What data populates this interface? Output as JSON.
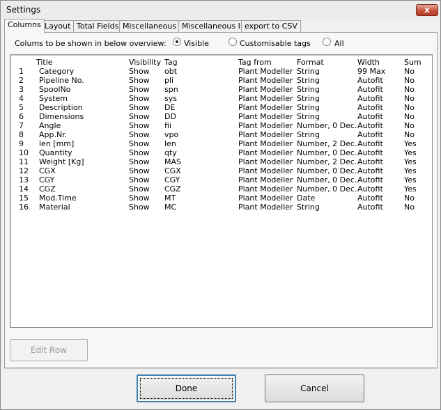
{
  "window": {
    "title": "Settings",
    "close_glyph": "x"
  },
  "tabs": [
    {
      "label": "Columns",
      "active": true
    },
    {
      "label": "Layout"
    },
    {
      "label": "Total Fields"
    },
    {
      "label": "Miscellaneous I"
    },
    {
      "label": "Miscellaneous II"
    },
    {
      "label": "export to CSV"
    }
  ],
  "filter": {
    "label": "Colums to be shown in below overview:",
    "options": [
      {
        "label": "Visible",
        "checked": true
      },
      {
        "label": "Customisable tags",
        "checked": false
      },
      {
        "label": "All",
        "checked": false
      }
    ]
  },
  "table": {
    "headers": [
      "",
      "Title",
      "Visibility",
      "Tag",
      "Tag from",
      "Format",
      "Width",
      "Sum"
    ],
    "rows": [
      [
        "1",
        "Category",
        "Show",
        "obt",
        "Plant Modeller",
        "String",
        "99 Max",
        "No"
      ],
      [
        "2",
        "Pipeline No.",
        "Show",
        "pli",
        "Plant Modeller",
        "String",
        "Autofit",
        "No"
      ],
      [
        "3",
        "SpoolNo",
        "Show",
        "spn",
        "Plant Modeller",
        "String",
        "Autofit",
        "No"
      ],
      [
        "4",
        "System",
        "Show",
        "sys",
        "Plant Modeller",
        "String",
        "Autofit",
        "No"
      ],
      [
        "5",
        "Description",
        "Show",
        "DE",
        "Plant Modeller",
        "String",
        "Autofit",
        "No"
      ],
      [
        "6",
        "Dimensions",
        "Show",
        "DD",
        "Plant Modeller",
        "String",
        "Autofit",
        "No"
      ],
      [
        "7",
        "Angle",
        "Show",
        "fii",
        "Plant Modeller",
        "Number, 0 Dec.",
        "Autofit",
        "No"
      ],
      [
        "8",
        "App.Nr.",
        "Show",
        "vpo",
        "Plant Modeller",
        "String",
        "Autofit",
        "No"
      ],
      [
        "9",
        "len [mm]",
        "Show",
        "len",
        "Plant Modeller",
        "Number, 2 Dec.",
        "Autofit",
        "Yes"
      ],
      [
        "10",
        "Quantity",
        "Show",
        "qty",
        "Plant Modeller",
        "Number, 0 Dec.",
        "Autofit",
        "Yes"
      ],
      [
        "11",
        "Weight [Kg]",
        "Show",
        "MAS",
        "Plant Modeller",
        "Number, 2 Dec.",
        "Autofit",
        "Yes"
      ],
      [
        "12",
        "CGX",
        "Show",
        "CGX",
        "Plant Modeller",
        "Number, 0 Dec.",
        "Autofit",
        "Yes"
      ],
      [
        "13",
        "CGY",
        "Show",
        "CGY",
        "Plant Modeller",
        "Number, 0 Dec.",
        "Autofit",
        "Yes"
      ],
      [
        "14",
        "CGZ",
        "Show",
        "CGZ",
        "Plant Modeller",
        "Number, 0 Dec.",
        "Autofit",
        "Yes"
      ],
      [
        "15",
        "Mod.Time",
        "Show",
        "MT",
        "Plant Modeller",
        "Date",
        "Autofit",
        "No"
      ],
      [
        "16",
        "Material",
        "Show",
        "MC",
        "Plant Modeller",
        "String",
        "Autofit",
        "No"
      ]
    ]
  },
  "buttons": {
    "edit_row": "Edit Row",
    "done": "Done",
    "cancel": "Cancel"
  }
}
